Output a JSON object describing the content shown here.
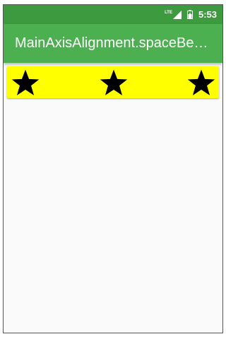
{
  "status_bar": {
    "network": "LTE",
    "time": "5:53"
  },
  "app_bar": {
    "title": "MainAxisAlignment.spaceBet..."
  },
  "row": {
    "background": "#ffff00",
    "items": [
      {
        "icon": "star-icon"
      },
      {
        "icon": "star-icon"
      },
      {
        "icon": "star-icon"
      }
    ]
  },
  "colors": {
    "status_bar": "#3d9a3f",
    "app_bar": "#4caf50",
    "icon": "#000000"
  }
}
